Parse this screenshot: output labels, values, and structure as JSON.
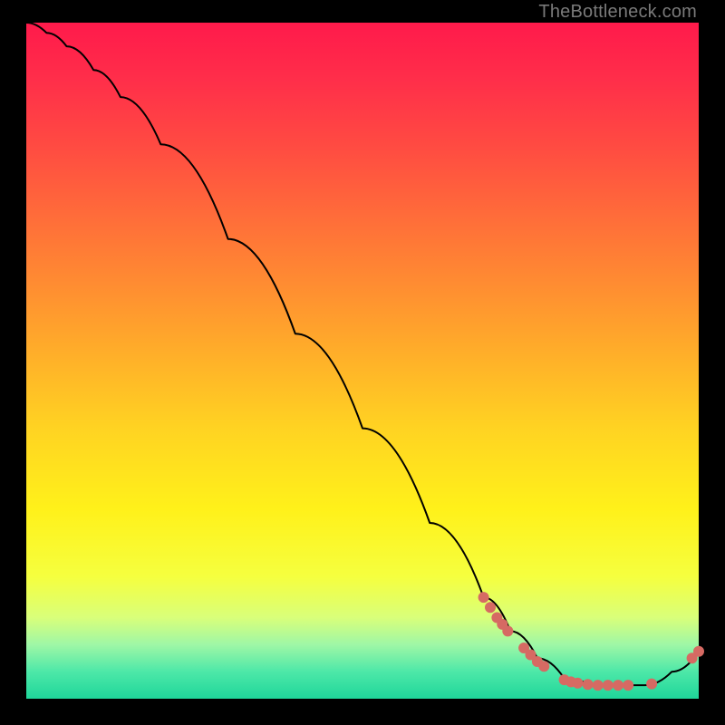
{
  "watermark_text": "TheBottleneck.com",
  "colors": {
    "background": "#000000",
    "curve": "#000000",
    "dot": "#d66a63",
    "gradient_top": "#ff1a4b",
    "gradient_bottom": "#1fd69a"
  },
  "chart_data": {
    "type": "line",
    "title": "",
    "xlabel": "",
    "ylabel": "",
    "xlim": [
      0,
      100
    ],
    "ylim": [
      0,
      100
    ],
    "grid": false,
    "legend": false,
    "series": [
      {
        "name": "bottleneck-curve",
        "x": [
          0,
          3,
          6,
          10,
          14,
          20,
          30,
          40,
          50,
          60,
          68,
          72,
          76,
          80,
          84,
          88,
          92,
          96,
          100
        ],
        "y": [
          100,
          98.5,
          96.5,
          93,
          89,
          82,
          68,
          54,
          40,
          26,
          15,
          10,
          6,
          3,
          2,
          2,
          2,
          4,
          7
        ]
      }
    ],
    "scatter": [
      {
        "name": "datapoints",
        "points": [
          {
            "x": 68,
            "y": 15
          },
          {
            "x": 69,
            "y": 13.5
          },
          {
            "x": 70,
            "y": 12
          },
          {
            "x": 70.8,
            "y": 11
          },
          {
            "x": 71.6,
            "y": 10
          },
          {
            "x": 74,
            "y": 7.5
          },
          {
            "x": 75,
            "y": 6.5
          },
          {
            "x": 76,
            "y": 5.5
          },
          {
            "x": 77,
            "y": 4.8
          },
          {
            "x": 80,
            "y": 2.8
          },
          {
            "x": 81,
            "y": 2.5
          },
          {
            "x": 82,
            "y": 2.3
          },
          {
            "x": 83.5,
            "y": 2.1
          },
          {
            "x": 85,
            "y": 2.0
          },
          {
            "x": 86.5,
            "y": 2.0
          },
          {
            "x": 88,
            "y": 2.0
          },
          {
            "x": 89.5,
            "y": 2.0
          },
          {
            "x": 93,
            "y": 2.2
          },
          {
            "x": 99,
            "y": 6.0
          },
          {
            "x": 100,
            "y": 7.0
          }
        ]
      }
    ]
  }
}
